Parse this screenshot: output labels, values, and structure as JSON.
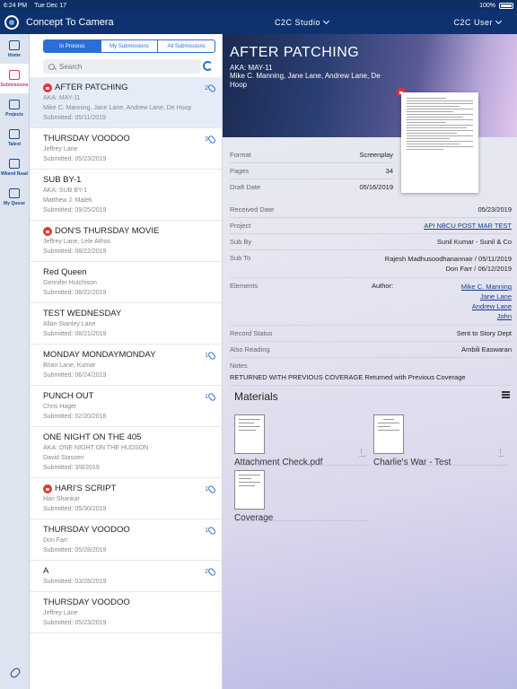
{
  "status_bar": {
    "time": "6:24 PM",
    "date": "Tue Dec 17",
    "battery": "100%"
  },
  "nav": {
    "title": "Concept To Camera",
    "studio": "C2C Studio",
    "user": "C2C User"
  },
  "rail": [
    {
      "label": "Home",
      "icon": "home-icon"
    },
    {
      "label": "Submissions",
      "icon": "submissions-icon"
    },
    {
      "label": "Projects",
      "icon": "projects-icon"
    },
    {
      "label": "Talent",
      "icon": "talent-icon"
    },
    {
      "label": "Wkend Read",
      "icon": "weekend-read-icon"
    },
    {
      "label": "My Queue",
      "icon": "queue-icon"
    }
  ],
  "tabs": [
    "In Process",
    "My Submissions",
    "All Submissions"
  ],
  "search": {
    "placeholder": "Search"
  },
  "submissions": [
    {
      "title": "AFTER PATCHING",
      "lock": true,
      "aka": "AKA: MAY-11",
      "people": "Mike C. Manning, Jane Lane, Andrew Lane, De Hoop",
      "submitted": "Submitted: 05/11/2019",
      "count": "2"
    },
    {
      "title": "THURSDAY VOODOO",
      "lock": false,
      "aka": "",
      "people": "Jeffrey Lane",
      "submitted": "Submitted: 05/23/2019",
      "count": "3"
    },
    {
      "title": "SUB BY-1",
      "lock": false,
      "aka": "AKA: SUB BY-1",
      "people": "Matthew J. Malek",
      "submitted": "Submitted: 09/25/2019",
      "count": ""
    },
    {
      "title": "DON'S THURSDAY MOVIE",
      "lock": true,
      "aka": "",
      "people": "Jeffrey Lane, Lele Athos",
      "submitted": "Submitted: 08/22/2019",
      "count": ""
    },
    {
      "title": "Red Queen",
      "lock": false,
      "aka": "",
      "people": "Gennifer Hutchison",
      "submitted": "Submitted: 08/22/2019",
      "count": ""
    },
    {
      "title": "TEST WEDNESDAY",
      "lock": false,
      "aka": "",
      "people": "Allan Stanley Lane",
      "submitted": "Submitted: 08/21/2019",
      "count": ""
    },
    {
      "title": "MONDAY MONDAYMONDAY",
      "lock": false,
      "aka": "",
      "people": "Brian Lane, Kumar",
      "submitted": "Submitted: 06/24/2019",
      "count": "1"
    },
    {
      "title": "PUNCH OUT",
      "lock": false,
      "aka": "",
      "people": "Chris Hager",
      "submitted": "Submitted: 02/20/2018",
      "count": "1"
    },
    {
      "title": "ONE NIGHT ON THE 405",
      "lock": false,
      "aka": "AKA: ONE NIGHT ON THE HUDSON",
      "people": "David Stassen",
      "submitted": "Submitted: 3/8/2019",
      "count": ""
    },
    {
      "title": "HARI'S SCRIPT",
      "lock": true,
      "aka": "",
      "people": "Hari Shankar",
      "submitted": "Submitted: 05/30/2019",
      "count": "1"
    },
    {
      "title": "THURSDAY VOODOO",
      "lock": false,
      "aka": "",
      "people": "Don Farr",
      "submitted": "Submitted: 05/28/2019",
      "count": "1"
    },
    {
      "title": "A",
      "lock": false,
      "aka": "",
      "people": "",
      "submitted": "Submitted: 03/28/2019",
      "count": "2"
    },
    {
      "title": "THURSDAY VOODOO",
      "lock": false,
      "aka": "",
      "people": "Jeffrey Lane",
      "submitted": "Submitted: 05/23/2019",
      "count": ""
    }
  ],
  "detail": {
    "title": "AFTER PATCHING",
    "aka": "AKA: MAY-11",
    "writers": "Mike C. Manning, Jane Lane, Andrew Lane, De Hoop",
    "format_k": "Format",
    "format_v": "Screenplay",
    "pages_k": "Pages",
    "pages_v": "34",
    "draft_k": "Draft Date",
    "draft_v": "05/16/2019",
    "received_k": "Received Date",
    "received_v": "05/23/2019",
    "project_k": "Project",
    "project_v": "API NBCU POST MAR TEST",
    "subby_k": "Sub By",
    "subby_v": "Sunil Kumar - Sunil & Co",
    "subto_k": "Sub To",
    "subto_v1": "Rajesh Madhusoodhanannair / 05/11/2019",
    "subto_v2": "Don Farr / 06/12/2019",
    "elements_k": "Elements",
    "author_label": "Author:",
    "authors": [
      "Mike C. Manning",
      "Jane Lane",
      "Andrew Lane",
      "John"
    ],
    "status_k": "Record Status",
    "status_v": "Sent to Story Dept",
    "also_k": "Also Reading",
    "also_v": "Ambili Easwaran",
    "notes_k": "Notes",
    "notes_v": "RETURNED WITH PREVIOUS COVERAGE Returned with Previous Coverage"
  },
  "materials": {
    "title": "Materials",
    "items": [
      "Attachment Check.pdf",
      "Charlie's War - Test",
      "Coverage"
    ]
  },
  "colors": {
    "nav": "#0e3270",
    "accent": "#2a6fd6",
    "lock": "#e33333",
    "active_rail": "#e0306a"
  }
}
